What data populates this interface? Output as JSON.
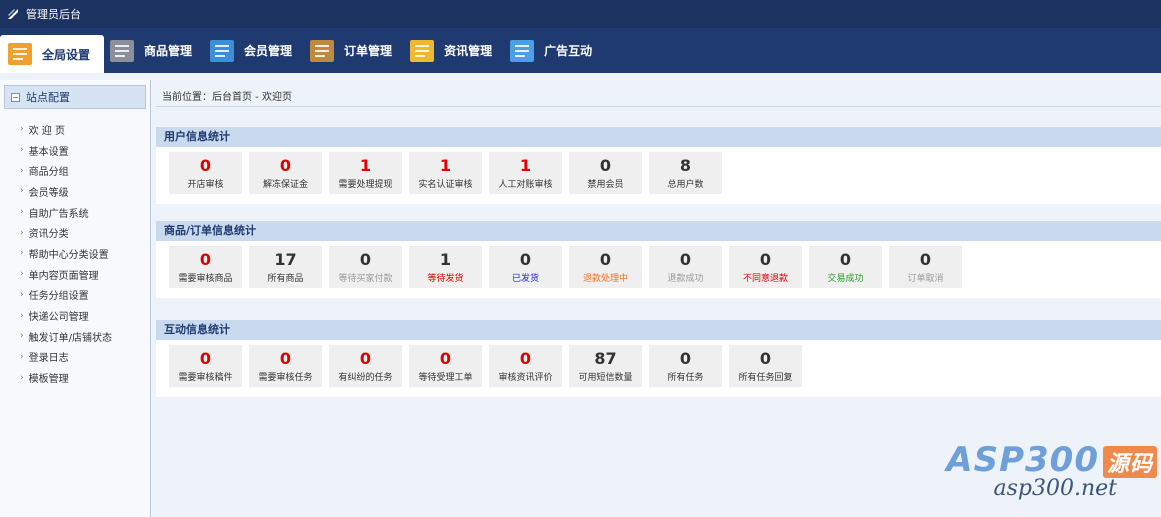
{
  "header": {
    "title": "管理员后台"
  },
  "nav": [
    {
      "label": "全局设置",
      "active": true,
      "icon": "settings-icon",
      "color": "#f0a030"
    },
    {
      "label": "商品管理",
      "active": false,
      "icon": "grid-icon",
      "color": "#8a8f99"
    },
    {
      "label": "会员管理",
      "active": false,
      "icon": "member-card-icon",
      "color": "#3a8fd8"
    },
    {
      "label": "订单管理",
      "active": false,
      "icon": "wallet-icon",
      "color": "#c08a3e"
    },
    {
      "label": "资讯管理",
      "active": false,
      "icon": "news-icon",
      "color": "#f0b830"
    },
    {
      "label": "广告互动",
      "active": false,
      "icon": "list-icon",
      "color": "#4aa0e8"
    }
  ],
  "sidebar": {
    "heading": "站点配置",
    "items": [
      "欢 迎 页",
      "基本设置",
      "商品分组",
      "会员等级",
      "自助广告系统",
      "资讯分类",
      "帮助中心分类设置",
      "单内容页面管理",
      "任务分组设置",
      "快递公司管理",
      "触发订单/店铺状态",
      "登录日志",
      "模板管理"
    ]
  },
  "breadcrumb": "当前位置：后台首页 - 欢迎页",
  "sections": [
    {
      "title": "用户信息统计",
      "stats": [
        {
          "value": "0",
          "label": "开店审核",
          "value_color": "#e00000",
          "label_color": "#333333"
        },
        {
          "value": "0",
          "label": "解冻保证金",
          "value_color": "#e00000",
          "label_color": "#333333"
        },
        {
          "value": "1",
          "label": "需要处理提现",
          "value_color": "#e00000",
          "label_color": "#333333"
        },
        {
          "value": "1",
          "label": "实名认证审核",
          "value_color": "#e00000",
          "label_color": "#333333"
        },
        {
          "value": "1",
          "label": "人工对账审核",
          "value_color": "#e00000",
          "label_color": "#333333"
        },
        {
          "value": "0",
          "label": "禁用会员",
          "value_color": "#333333",
          "label_color": "#333333"
        },
        {
          "value": "8",
          "label": "总用户数",
          "value_color": "#333333",
          "label_color": "#333333"
        }
      ]
    },
    {
      "title": "商品/订单信息统计",
      "stats": [
        {
          "value": "0",
          "label": "需要审核商品",
          "value_color": "#e00000",
          "label_color": "#333333"
        },
        {
          "value": "17",
          "label": "所有商品",
          "value_color": "#333333",
          "label_color": "#333333"
        },
        {
          "value": "0",
          "label": "等待买家付款",
          "value_color": "#333333",
          "label_color": "#999999"
        },
        {
          "value": "1",
          "label": "等待发货",
          "value_color": "#333333",
          "label_color": "#e00000"
        },
        {
          "value": "0",
          "label": "已发货",
          "value_color": "#333333",
          "label_color": "#2a2ad8"
        },
        {
          "value": "0",
          "label": "退款处理中",
          "value_color": "#333333",
          "label_color": "#f07020"
        },
        {
          "value": "0",
          "label": "退款成功",
          "value_color": "#333333",
          "label_color": "#999999"
        },
        {
          "value": "0",
          "label": "不同意退款",
          "value_color": "#333333",
          "label_color": "#e00000"
        },
        {
          "value": "0",
          "label": "交易成功",
          "value_color": "#333333",
          "label_color": "#2a9a2a"
        },
        {
          "value": "0",
          "label": "订单取消",
          "value_color": "#333333",
          "label_color": "#999999"
        }
      ]
    },
    {
      "title": "互动信息统计",
      "stats": [
        {
          "value": "0",
          "label": "需要审核稿件",
          "value_color": "#e00000",
          "label_color": "#333333"
        },
        {
          "value": "0",
          "label": "需要审核任务",
          "value_color": "#e00000",
          "label_color": "#333333"
        },
        {
          "value": "0",
          "label": "有纠纷的任务",
          "value_color": "#e00000",
          "label_color": "#333333"
        },
        {
          "value": "0",
          "label": "等待受理工单",
          "value_color": "#e00000",
          "label_color": "#333333"
        },
        {
          "value": "0",
          "label": "审核资讯评价",
          "value_color": "#e00000",
          "label_color": "#333333"
        },
        {
          "value": "87",
          "label": "可用短信数量",
          "value_color": "#333333",
          "label_color": "#333333"
        },
        {
          "value": "0",
          "label": "所有任务",
          "value_color": "#333333",
          "label_color": "#333333"
        },
        {
          "value": "0",
          "label": "所有任务回复",
          "value_color": "#333333",
          "label_color": "#333333"
        }
      ]
    }
  ],
  "watermark": {
    "brand": "ASP300",
    "tag": "源码",
    "domain": "asp300.net"
  }
}
